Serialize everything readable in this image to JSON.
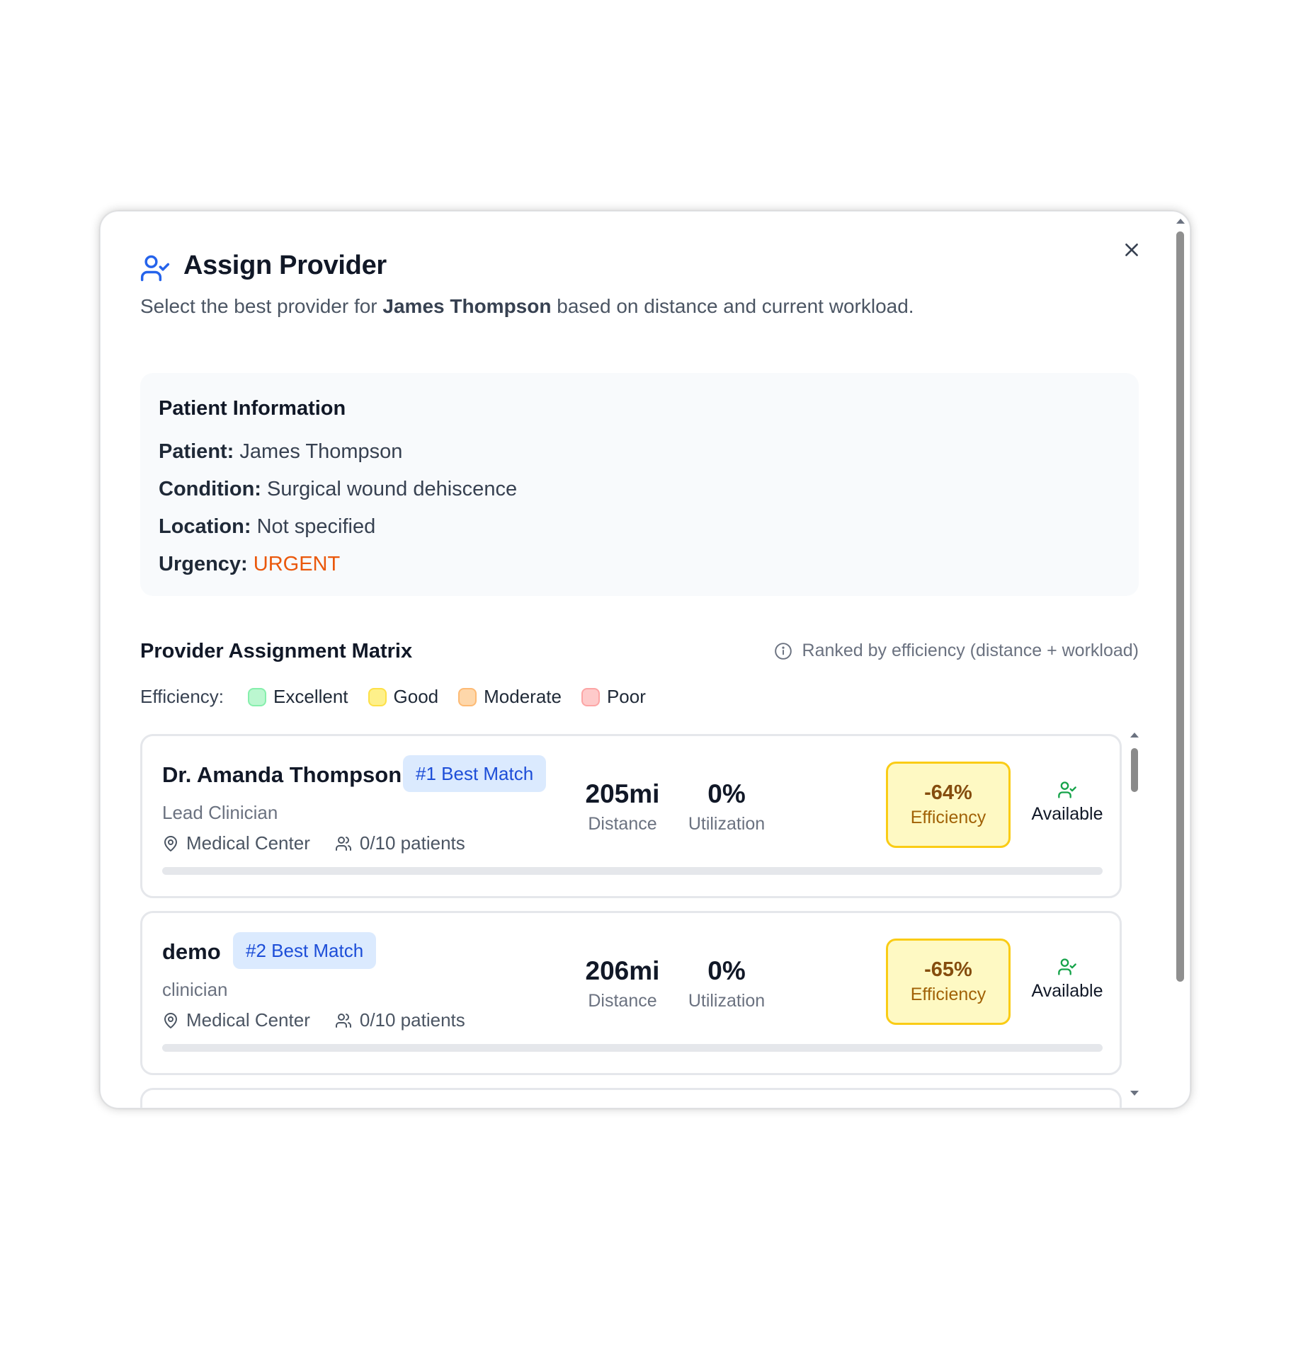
{
  "dialog": {
    "title": "Assign Provider",
    "subtitle_prefix": "Select the best provider for ",
    "subtitle_patient": "James Thompson",
    "subtitle_suffix": " based on distance and current workload."
  },
  "patient_info": {
    "heading": "Patient Information",
    "patient_label": "Patient:",
    "patient_value": "James Thompson",
    "condition_label": "Condition:",
    "condition_value": "Surgical wound dehiscence",
    "location_label": "Location:",
    "location_value": "Not specified",
    "urgency_label": "Urgency:",
    "urgency_value": "URGENT"
  },
  "matrix": {
    "title": "Provider Assignment Matrix",
    "ranked_note": "Ranked by efficiency (distance + workload)",
    "legend_label": "Efficiency:",
    "legend": [
      {
        "label": "Excellent",
        "color": "#bbf7d0",
        "border": "#86efac"
      },
      {
        "label": "Good",
        "color": "#fef08a",
        "border": "#fde047"
      },
      {
        "label": "Moderate",
        "color": "#fed7aa",
        "border": "#fdba74"
      },
      {
        "label": "Poor",
        "color": "#fecaca",
        "border": "#fca5a5"
      }
    ]
  },
  "providers": [
    {
      "name": "Dr. Amanda Thompson",
      "badge": "#1 Best Match",
      "role": "Lead Clinician",
      "location": "Medical Center",
      "patients": "0/10 patients",
      "distance": "205mi",
      "distance_label": "Distance",
      "utilization": "0%",
      "utilization_label": "Utilization",
      "efficiency": "-64%",
      "efficiency_label": "Efficiency",
      "status": "Available",
      "load_fraction": 0
    },
    {
      "name": "demo",
      "badge": "#2 Best Match",
      "role": "clinician",
      "location": "Medical Center",
      "patients": "0/10 patients",
      "distance": "206mi",
      "distance_label": "Distance",
      "utilization": "0%",
      "utilization_label": "Utilization",
      "efficiency": "-65%",
      "efficiency_label": "Efficiency",
      "status": "Available",
      "load_fraction": 0
    }
  ],
  "icons": {
    "header": "user-check-icon",
    "close": "close-icon",
    "info": "info-icon",
    "location": "map-pin-icon",
    "patients": "users-icon",
    "available": "user-check-icon"
  },
  "colors": {
    "accent": "#2563eb",
    "urgent": "#ea580c",
    "badge_bg": "#dbeafe",
    "badge_text": "#1d4ed8",
    "available": "#16a34a",
    "efficiency_bg": "#fef9c3",
    "efficiency_border": "#facc15"
  }
}
